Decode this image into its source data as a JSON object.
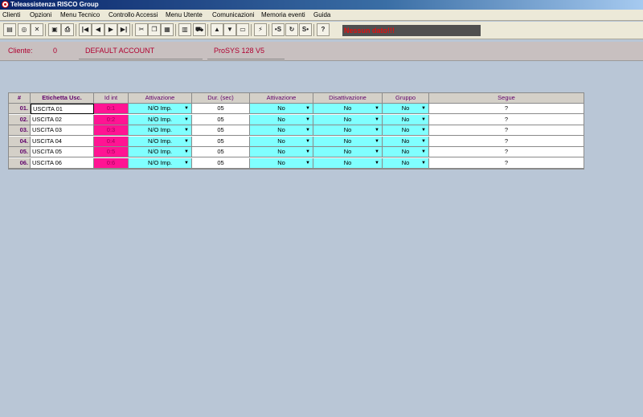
{
  "window": {
    "title": "Teleassistenza RISCO Group"
  },
  "menu": [
    "Clienti",
    "Opzioni",
    "Menu Tecnico",
    "Controllo Accessi",
    "Menu Utente",
    "Comunicazioni",
    "Memoria eventi",
    "Guida"
  ],
  "toolbar": {
    "buttons": [
      {
        "name": "new-icon",
        "glyph": "▤"
      },
      {
        "name": "search-icon",
        "glyph": "◎"
      },
      {
        "name": "close-icon",
        "glyph": "✕"
      },
      {
        "name": "save-icon",
        "glyph": "▣"
      },
      {
        "name": "print-icon",
        "glyph": "⎙"
      },
      {
        "name": "first-record-icon",
        "glyph": "|◀"
      },
      {
        "name": "prev-record-icon",
        "glyph": "◀"
      },
      {
        "name": "next-record-icon",
        "glyph": "▶"
      },
      {
        "name": "last-record-icon",
        "glyph": "▶|"
      },
      {
        "name": "cut-icon",
        "glyph": "✂"
      },
      {
        "name": "copy-icon",
        "glyph": "❐"
      },
      {
        "name": "paste-icon",
        "glyph": "▦"
      },
      {
        "name": "book-icon",
        "glyph": "▥"
      },
      {
        "name": "car-icon",
        "glyph": "⛟"
      },
      {
        "name": "computer-upload-icon",
        "glyph": "▲"
      },
      {
        "name": "computer-download-icon",
        "glyph": "▼"
      },
      {
        "name": "computer-icon",
        "glyph": "▭"
      },
      {
        "name": "connect-icon",
        "glyph": "⚡"
      },
      {
        "name": "send-s-icon",
        "glyph": "•S"
      },
      {
        "name": "refresh-icon",
        "glyph": "↻"
      },
      {
        "name": "receive-s-icon",
        "glyph": "S•"
      },
      {
        "name": "help-icon",
        "glyph": "?"
      }
    ],
    "status_text": "Nessun dato!!!"
  },
  "info": {
    "cliente_label": "Cliente:",
    "cliente_id": "0",
    "account": "DEFAULT ACCOUNT",
    "model": "ProSYS 128 V5"
  },
  "grid": {
    "headers": [
      "#",
      "Etichetta Usc.",
      "Id int",
      "Attivazione",
      "Dur. (sec)",
      "Attivazione",
      "Disattivazione",
      "Gruppo",
      "Segue"
    ],
    "rows": [
      {
        "idx": "01.",
        "label": "USCITA 01",
        "id": "0:1",
        "attivazione": "N/O Imp.",
        "durata": "05",
        "attivazione2": "No",
        "disattivazione": "No",
        "gruppo": "No",
        "segue": "?"
      },
      {
        "idx": "02.",
        "label": "USCITA 02",
        "id": "0:2",
        "attivazione": "N/O Imp.",
        "durata": "05",
        "attivazione2": "No",
        "disattivazione": "No",
        "gruppo": "No",
        "segue": "?"
      },
      {
        "idx": "03.",
        "label": "USCITA 03",
        "id": "0:3",
        "attivazione": "N/O Imp.",
        "durata": "05",
        "attivazione2": "No",
        "disattivazione": "No",
        "gruppo": "No",
        "segue": "?"
      },
      {
        "idx": "04.",
        "label": "USCITA 04",
        "id": "0:4",
        "attivazione": "N/O Imp.",
        "durata": "05",
        "attivazione2": "No",
        "disattivazione": "No",
        "gruppo": "No",
        "segue": "?"
      },
      {
        "idx": "05.",
        "label": "USCITA 05",
        "id": "0:5",
        "attivazione": "N/O Imp.",
        "durata": "05",
        "attivazione2": "No",
        "disattivazione": "No",
        "gruppo": "No",
        "segue": "?"
      },
      {
        "idx": "06.",
        "label": "USCITA 06",
        "id": "0:6",
        "attivazione": "N/O Imp.",
        "durata": "05",
        "attivazione2": "No",
        "disattivazione": "No",
        "gruppo": "No",
        "segue": "?"
      }
    ]
  },
  "colors": {
    "id_cell": "#ff1493",
    "dropdown_cell": "#80ffff"
  }
}
